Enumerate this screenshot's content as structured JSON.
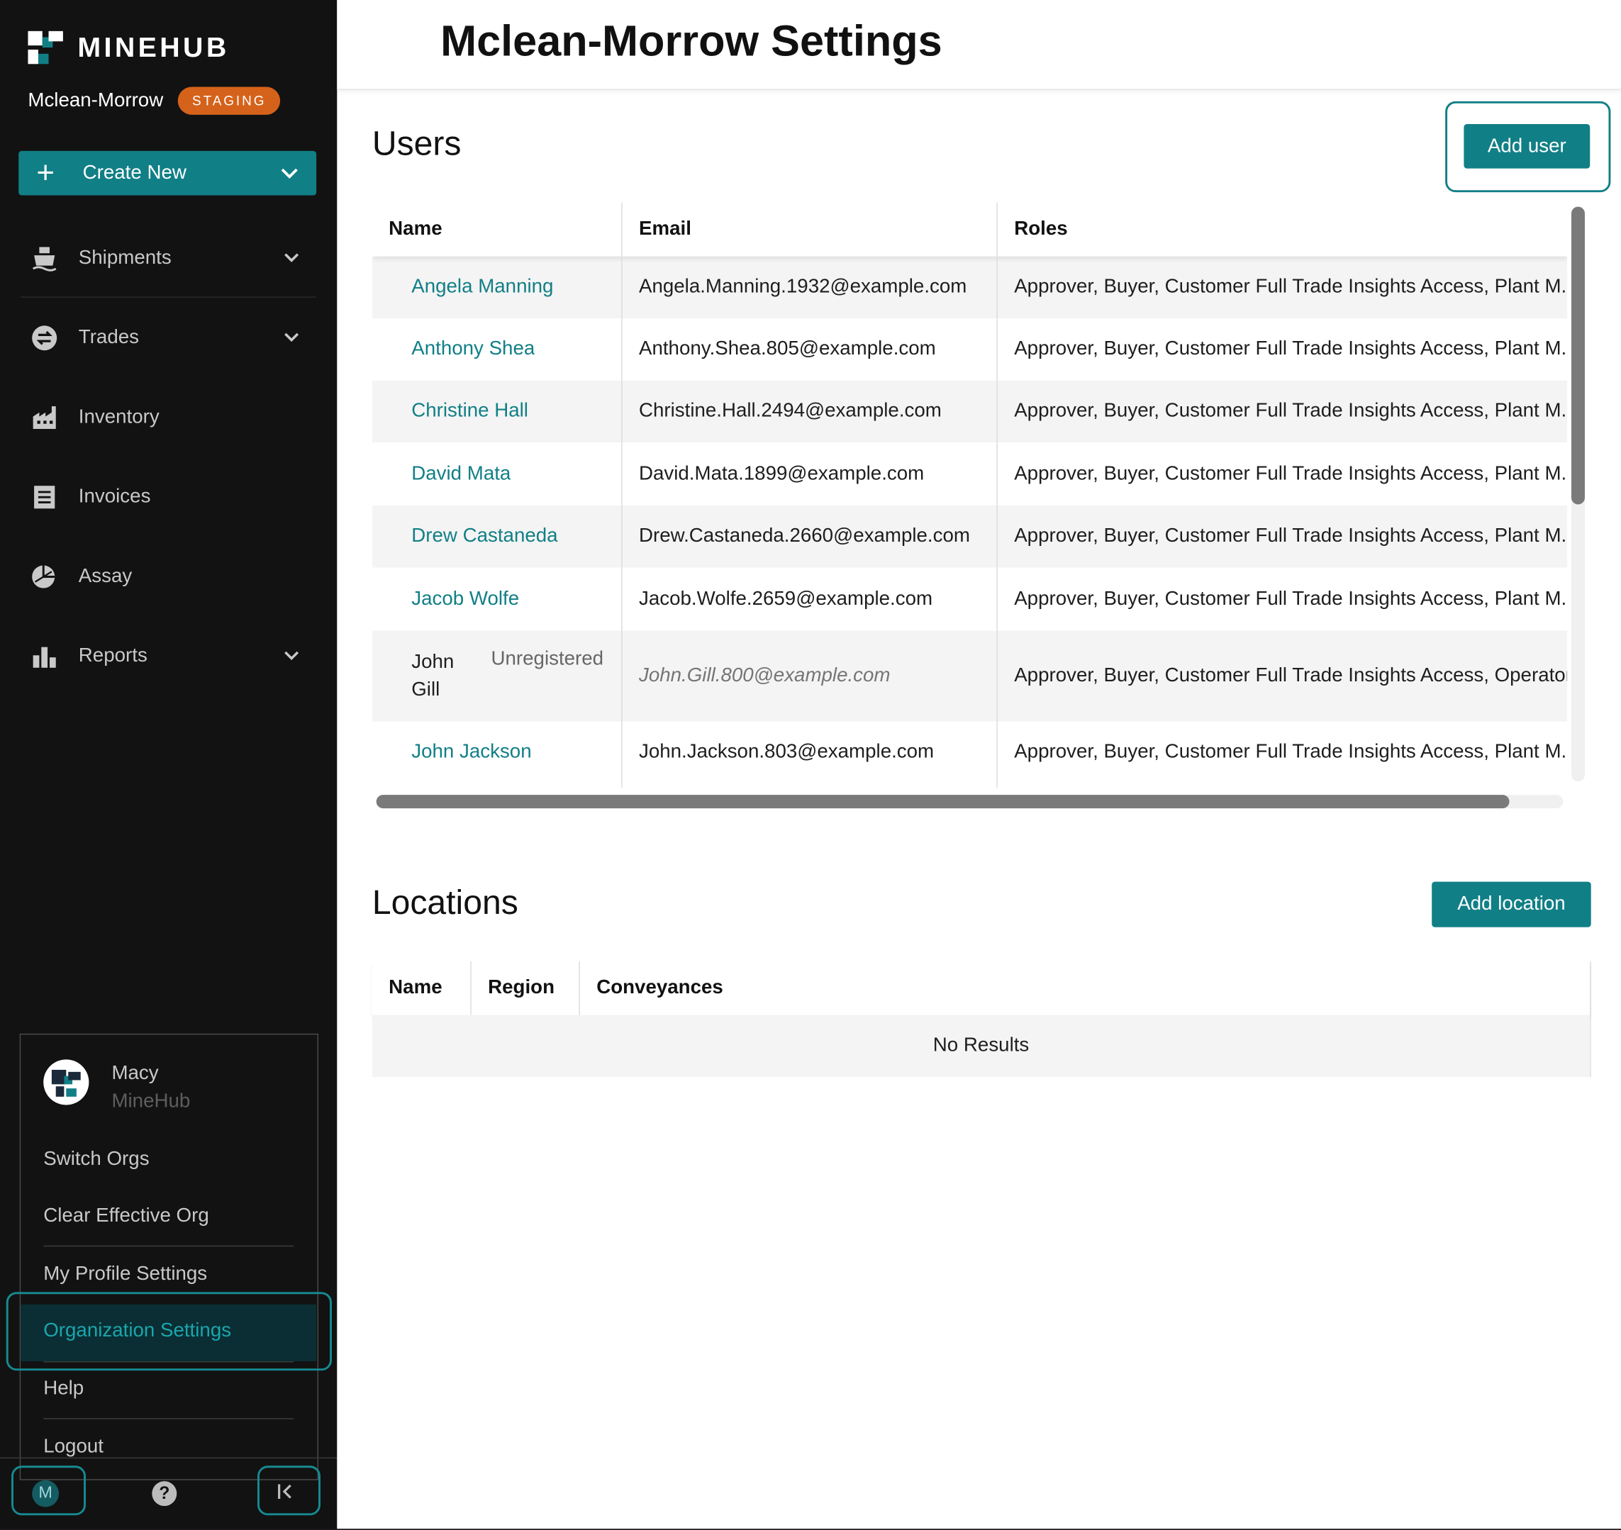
{
  "brand": {
    "name": "MINEHUB"
  },
  "org": {
    "name": "Mclean-Morrow",
    "env_badge": "STAGING"
  },
  "create_new": {
    "label": "Create New"
  },
  "nav": {
    "shipments": "Shipments",
    "trades": "Trades",
    "inventory": "Inventory",
    "invoices": "Invoices",
    "assay": "Assay",
    "reports": "Reports"
  },
  "user_menu": {
    "user_name": "Macy",
    "user_org": "MineHub",
    "switch_orgs": "Switch Orgs",
    "clear_effective_org": "Clear Effective Org",
    "my_profile_settings": "My Profile Settings",
    "organization_settings": "Organization Settings",
    "help": "Help",
    "logout": "Logout"
  },
  "bottom_bar": {
    "avatar_initial": "M",
    "help_glyph": "?",
    "collapse_glyph": "I<"
  },
  "page": {
    "title": "Mclean-Morrow Settings"
  },
  "users": {
    "title": "Users",
    "add_button": "Add user",
    "columns": {
      "name": "Name",
      "email": "Email",
      "roles": "Roles"
    },
    "rows": [
      {
        "name": "Angela Manning",
        "email": "Angela.Manning.1932@example.com",
        "roles": "Approver, Buyer, Customer Full Trade Insights Access, Plant M.."
      },
      {
        "name": "Anthony Shea",
        "email": "Anthony.Shea.805@example.com",
        "roles": "Approver, Buyer, Customer Full Trade Insights Access, Plant M.."
      },
      {
        "name": "Christine Hall",
        "email": "Christine.Hall.2494@example.com",
        "roles": "Approver, Buyer, Customer Full Trade Insights Access, Plant M.."
      },
      {
        "name": "David Mata",
        "email": "David.Mata.1899@example.com",
        "roles": "Approver, Buyer, Customer Full Trade Insights Access, Plant M.."
      },
      {
        "name": "Drew Castaneda",
        "email": "Drew.Castaneda.2660@example.com",
        "roles": "Approver, Buyer, Customer Full Trade Insights Access, Plant M.."
      },
      {
        "name": "Jacob Wolfe",
        "email": "Jacob.Wolfe.2659@example.com",
        "roles": "Approver, Buyer, Customer Full Trade Insights Access, Plant M.."
      },
      {
        "name": "John Gill",
        "status": "Unregistered",
        "email": "John.Gill.800@example.com",
        "roles": "Approver, Buyer, Customer Full Trade Insights Access, Operator"
      },
      {
        "name": "John Jackson",
        "email": "John.Jackson.803@example.com",
        "roles": "Approver, Buyer, Customer Full Trade Insights Access, Plant M.."
      }
    ]
  },
  "locations": {
    "title": "Locations",
    "add_button": "Add location",
    "columns": {
      "name": "Name",
      "region": "Region",
      "conveyances": "Conveyances"
    },
    "empty_text": "No Results"
  },
  "colors": {
    "accent": "#117f86",
    "badge": "#d5621b",
    "sidebar": "#121212"
  },
  "icons": [
    "ship-icon",
    "trades-icon",
    "factory-icon",
    "invoice-icon",
    "assay-icon",
    "bar-chart-icon",
    "chevron-down-icon",
    "plus-icon",
    "help-icon",
    "collapse-icon"
  ]
}
